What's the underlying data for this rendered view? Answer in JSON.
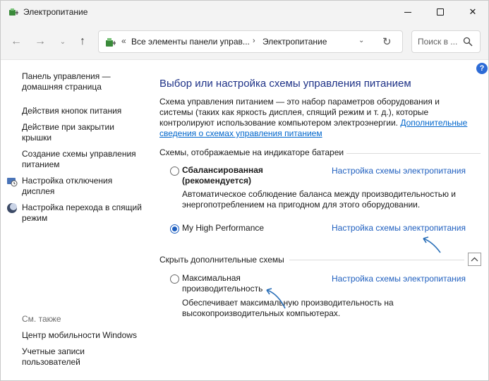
{
  "window": {
    "title": "Электропитание",
    "app_icon": "power-options-icon",
    "minimize_icon": "minimize-icon",
    "maximize_icon": "maximize-icon",
    "close_icon": "close-icon",
    "close_glyph": "✕"
  },
  "nav": {
    "back_glyph": "←",
    "forward_glyph": "→",
    "recent_glyph": "⌄",
    "up_glyph": "↑",
    "breadcrumb_sep": "«",
    "breadcrumb": [
      "Все элементы панели управ...",
      "Электропитание"
    ],
    "crumb_arrow": "›",
    "dropdown_glyph": "⌄",
    "refresh_glyph": "↻",
    "search_placeholder": "Поиск в ..."
  },
  "help": {
    "glyph": "?"
  },
  "sidebar": {
    "home_link": "Панель управления — домашняя страница",
    "links": [
      "Действия кнопок питания",
      "Действие при закрытии крышки",
      "Создание схемы управления питанием",
      "Настройка отключения дисплея",
      "Настройка перехода в спящий режим"
    ],
    "see_also_label": "См. также",
    "see_also": [
      "Центр мобильности Windows",
      "Учетные записи пользователей"
    ]
  },
  "main": {
    "title": "Выбор или настройка схемы управления питанием",
    "description": "Схема управления питанием — это набор параметров оборудования и системы (таких как яркость дисплея, спящий режим и т. д.), которые контролируют использование компьютером электроэнергии.",
    "description_link": "Дополнительные сведения о схемах управления питанием",
    "battery_section": "Схемы, отображаемые на индикаторе батареи",
    "hidden_section": "Скрыть дополнительные схемы",
    "plans": [
      {
        "name": "Сбалансированная (рекомендуется)",
        "description": "Автоматическое соблюдение баланса между производительностью и энергопотреблением на пригодном для этого оборудовании.",
        "link": "Настройка схемы электропитания",
        "selected": false
      },
      {
        "name": "My High Performance",
        "description": "",
        "link": "Настройка схемы электропитания",
        "selected": true
      },
      {
        "name": "Максимальная производительность",
        "description": "Обеспечивает максимальную производительность на высокопроизводительных компьютерах.",
        "link": "Настройка схемы электропитания",
        "selected": false
      }
    ],
    "collapse_glyph": "︿"
  },
  "colors": {
    "title_blue": "#1e3287",
    "link_blue": "#1f5fbf",
    "annotation_arrow": "#2a6fb8"
  }
}
